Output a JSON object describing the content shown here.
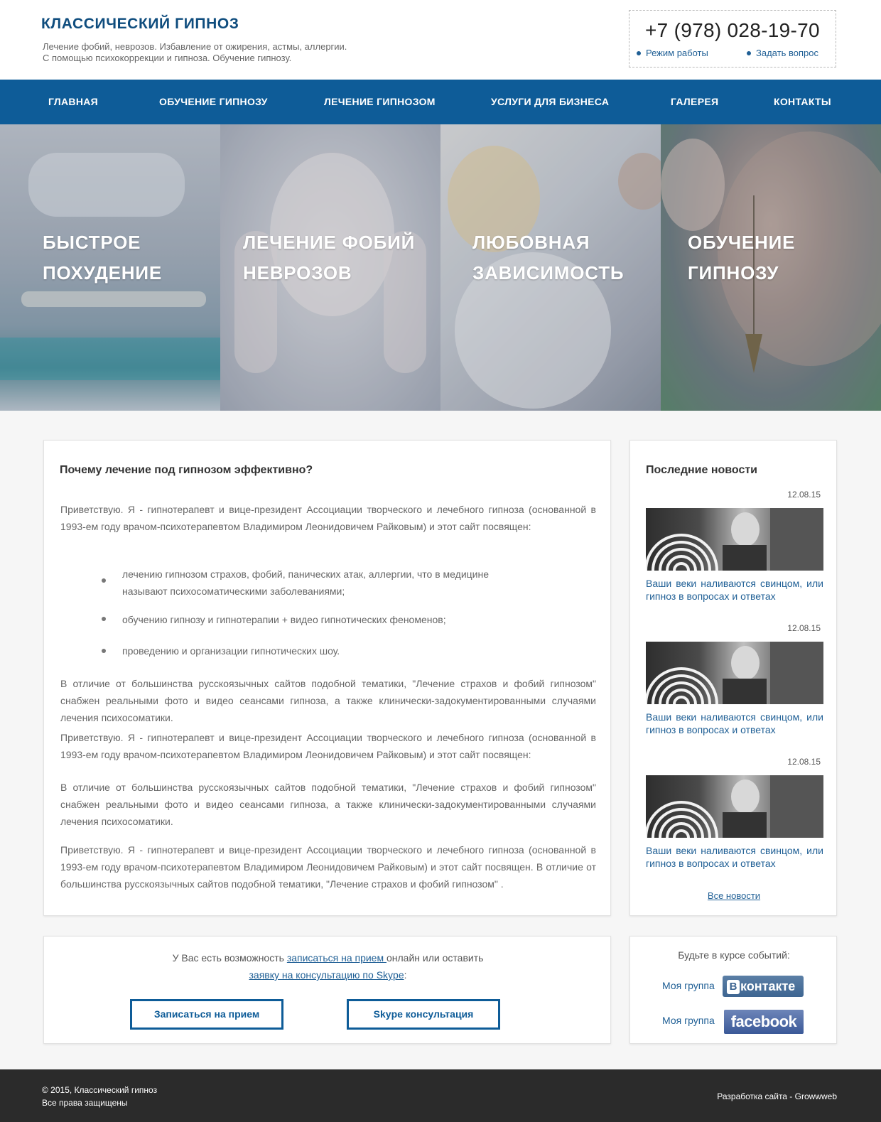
{
  "header": {
    "site_title": "КЛАССИЧЕСКИЙ ГИПНОЗ",
    "tagline_line1": "Лечение фобий, неврозов. Избавление от ожирения, астмы, аллергии.",
    "tagline_line2": "С помощью психокоррекции и гипноза.  Обучение гипнозу.",
    "phone": "+7 (978) 028-19-70",
    "link_hours": "Режим работы",
    "link_ask": "Задать вопрос"
  },
  "nav": [
    {
      "label": "ГЛАВНАЯ"
    },
    {
      "label": "ОБУЧЕНИЕ ГИПНОЗУ"
    },
    {
      "label": "ЛЕЧЕНИЕ ГИПНОЗОМ"
    },
    {
      "label": "УСЛУГИ ДЛЯ БИЗНЕСА"
    },
    {
      "label": "ГАЛЕРЕЯ"
    },
    {
      "label": "КОНТАКТЫ"
    }
  ],
  "hero": [
    {
      "line1": "БЫСТРОЕ",
      "line2": "ПОХУДЕНИЕ"
    },
    {
      "line1": "ЛЕЧЕНИЕ ФОБИЙ",
      "line2": "НЕВРОЗОВ"
    },
    {
      "line1": "ЛЮБОВНАЯ",
      "line2": "ЗАВИСИМОСТЬ"
    },
    {
      "line1": "ОБУЧЕНИЕ",
      "line2": "ГИПНОЗУ"
    }
  ],
  "main": {
    "title": "Почему лечение под гипнозом эффективно?",
    "intro": "Приветствую. Я - гипнотерапевт и вице-президент Ассоциации творческого и лечебного гипноза (основанной в 1993-ем году врачом-психотерапевтом Владимиром Леонидовичем Райковым) и этот сайт посвящен:",
    "bullets": [
      "лечению гипнозом страхов, фобий, панических атак, аллергии, что в медицине называют психосоматическими заболеваниями;",
      "обучению гипнозу и гипнотерапии + видео гипнотических феноменов;",
      "проведению и организации гипнотических шоу."
    ],
    "para2": "В отличие от большинства русскоязычных сайтов подобной тематики, \"Лечение страхов и фобий гипнозом\" снабжен реальными фото и видео сеансами гипноза, а также клинически-задокументированными случаями лечения психосоматики.",
    "para3": "Приветствую. Я - гипнотерапевт и вице-президент Ассоциации творческого и лечебного гипноза  (основанной в 1993-ем году врачом-психотерапевтом Владимиром Леонидовичем Райковым) и этот сайт посвящен:",
    "para4": "В отличие от большинства русскоязычных сайтов подобной тематики, \"Лечение страхов и фобий гипнозом\" снабжен реальными фото и видео сеансами гипноза, а также клинически-задокументированными случаями лечения психосоматики.",
    "para5": "Приветствую. Я - гипнотерапевт и вице-президент Ассоциации творческого и лечебного гипноза  (основанной в 1993-ем году врачом-психотерапевтом Владимиром Леонидовичем Райковым) и этот сайт посвящен. В отличие от большинства русскоязычных сайтов подобной тематики, \"Лечение страхов и фобий гипнозом\" ."
  },
  "news": {
    "title": "Последние новости",
    "items": [
      {
        "date": "12.08.15",
        "text": "Ваши веки наливаются свинцом, или гипноз в вопросах и ответах"
      },
      {
        "date": "12.08.15",
        "text": "Ваши веки наливаются свинцом, или гипноз в вопросах и ответах"
      },
      {
        "date": "12.08.15",
        "text": "Ваши веки наливаются свинцом, или гипноз в вопросах и ответах"
      }
    ],
    "all_news": "Все новости"
  },
  "cta": {
    "text_a": "У Вас есть возможность ",
    "link_appt": "записаться на прием ",
    "text_b": "онлайн или оставить",
    "link_skype": "заявку на консультацию по Skype",
    "text_c": ":",
    "btn_appt": "Записаться на прием",
    "btn_skype": "Skype консультация"
  },
  "social": {
    "heading": "Будьте в курсе событий:",
    "label_vk": "Моя группа",
    "label_fb": "Моя группа",
    "vk_logo_b": "В",
    "vk_logo_rest": "контакте",
    "fb_logo": "facebook"
  },
  "footer": {
    "copyright": "© 2015,  Классический гипноз",
    "rights": "Все права защищены",
    "dev": "Разработка сайта - Growwweb"
  },
  "colors": {
    "brand_blue": "#0e5c98",
    "link_blue": "#1f5f95",
    "footer_bg": "#2b2b2b"
  }
}
